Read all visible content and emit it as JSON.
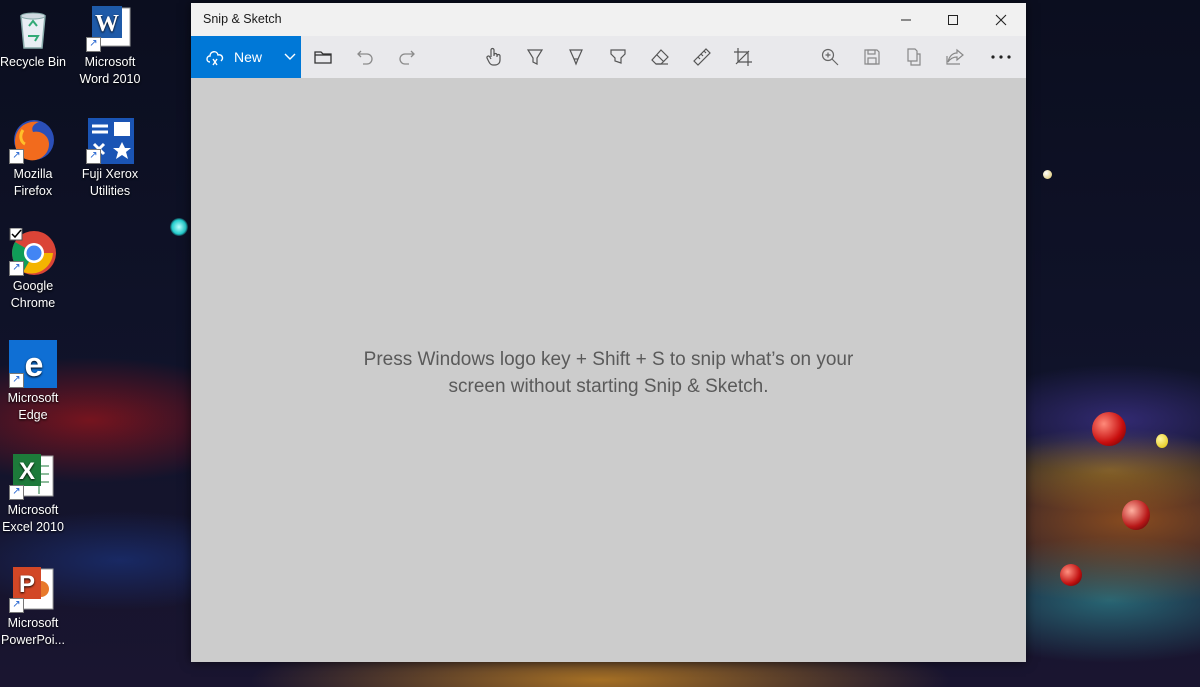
{
  "desktop": {
    "icons": [
      {
        "label": "Recycle Bin",
        "icon": "recycle-bin-icon"
      },
      {
        "label": "Microsoft Word 2010",
        "icon": "word-icon"
      },
      {
        "label": "Mozilla Firefox",
        "icon": "firefox-icon"
      },
      {
        "label": "Fuji Xerox Utilities",
        "icon": "fuji-xerox-icon"
      },
      {
        "label": "Google Chrome",
        "icon": "chrome-icon"
      },
      {
        "label": "Microsoft Edge",
        "icon": "edge-icon"
      },
      {
        "label": "Microsoft Excel 2010",
        "icon": "excel-icon"
      },
      {
        "label": "Microsoft PowerPoi...",
        "icon": "powerpoint-icon"
      }
    ]
  },
  "window": {
    "title": "Snip & Sketch",
    "controls": [
      "minimize-icon",
      "maximize-icon",
      "close-icon"
    ]
  },
  "toolbar": {
    "new_label": "New",
    "tools": [
      "open-folder-icon",
      "undo-icon",
      "redo-icon",
      "touch-writing-icon",
      "ballpoint-pen-icon",
      "pencil-icon",
      "highlighter-icon",
      "eraser-icon",
      "ruler-icon",
      "crop-icon",
      "zoom-icon",
      "save-icon",
      "copy-icon",
      "share-icon",
      "more-icon"
    ]
  },
  "canvas": {
    "hint_line1": "Press Windows logo key + Shift + S to snip what’s on your",
    "hint_line2": "screen without starting Snip & Sketch."
  },
  "colors": {
    "accent": "#0078d7",
    "canvas": "#cccccc",
    "titlebar": "#f1f1f1"
  }
}
